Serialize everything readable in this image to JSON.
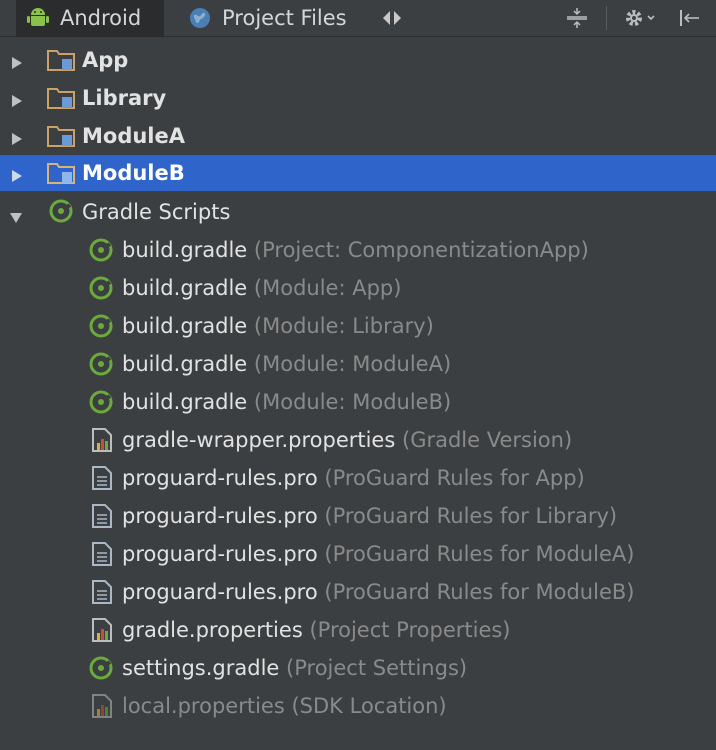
{
  "toolbar": {
    "tabs": [
      {
        "label": "Android"
      },
      {
        "label": "Project Files"
      }
    ]
  },
  "tree": {
    "modules": [
      {
        "label": "App"
      },
      {
        "label": "Library"
      },
      {
        "label": "ModuleA"
      },
      {
        "label": "ModuleB"
      }
    ],
    "gradle_scripts": {
      "label": "Gradle Scripts",
      "files": [
        {
          "name": "build.gradle",
          "hint": "(Project: ComponentizationApp)"
        },
        {
          "name": "build.gradle",
          "hint": "(Module: App)"
        },
        {
          "name": "build.gradle",
          "hint": "(Module: Library)"
        },
        {
          "name": "build.gradle",
          "hint": "(Module: ModuleA)"
        },
        {
          "name": "build.gradle",
          "hint": "(Module: ModuleB)"
        },
        {
          "name": "gradle-wrapper.properties",
          "hint": "(Gradle Version)"
        },
        {
          "name": "proguard-rules.pro",
          "hint": "(ProGuard Rules for App)"
        },
        {
          "name": "proguard-rules.pro",
          "hint": "(ProGuard Rules for Library)"
        },
        {
          "name": "proguard-rules.pro",
          "hint": "(ProGuard Rules for ModuleA)"
        },
        {
          "name": "proguard-rules.pro",
          "hint": "(ProGuard Rules for ModuleB)"
        },
        {
          "name": "gradle.properties",
          "hint": "(Project Properties)"
        },
        {
          "name": "settings.gradle",
          "hint": "(Project Settings)"
        },
        {
          "name": "local.properties",
          "hint": "(SDK Location)"
        }
      ]
    }
  },
  "colors": {
    "background": "#3c3f41",
    "selection": "#2f65ca",
    "gradle_green": "#6aab3c",
    "folder": "#c9a26a",
    "module_badge": "#6c9ad6",
    "hint_text": "#8a8a8a"
  }
}
